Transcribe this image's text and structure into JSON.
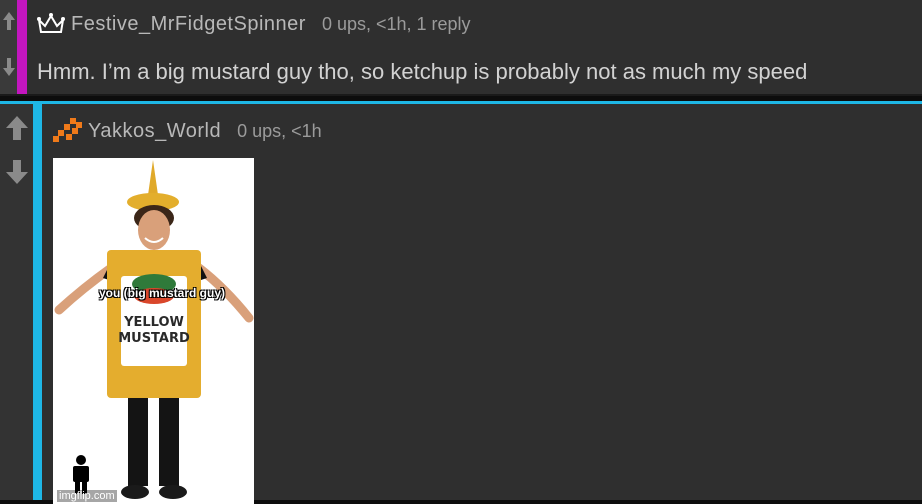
{
  "comments": [
    {
      "username": "Festive_MrFidgetSpinner",
      "meta": "0 ups, <1h, 1 reply",
      "text": "Hmm. I’m a big mustard guy tho, so ketchup is probably not as much my speed",
      "avatar_icon": "crown-icon",
      "accent_color": "#c316bf"
    },
    {
      "username": "Yakkos_World",
      "meta": "0 ups, <1h",
      "avatar_icon": "pixel-avatar-icon",
      "accent_color": "#1eb7e6",
      "image": {
        "caption": "you (big mustard guy)",
        "bottle_label_line1": "YELLOW",
        "bottle_label_line2": "MUSTARD",
        "watermark": "imgflip.com"
      }
    }
  ]
}
